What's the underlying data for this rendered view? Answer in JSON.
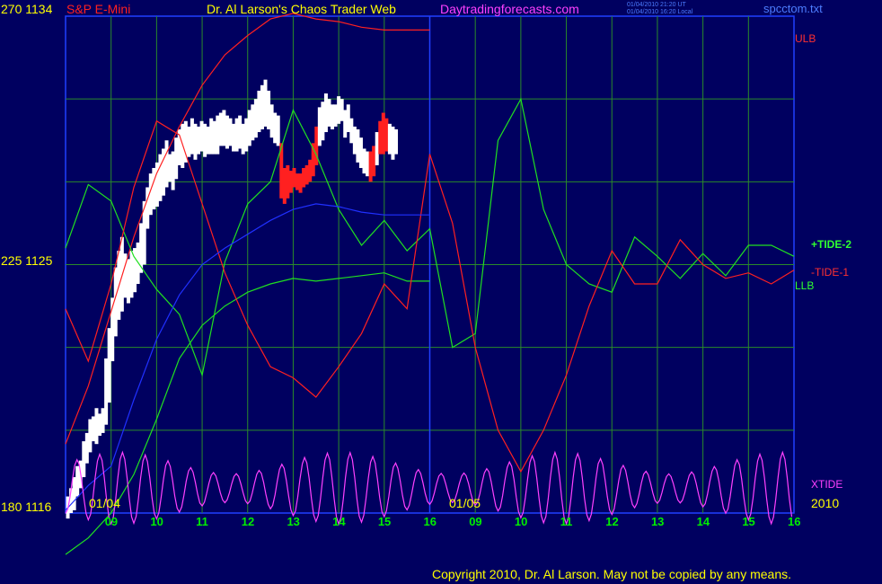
{
  "header": {
    "instrument": "S&P E-Mini",
    "title": "Dr. Al Larson's Chaos Trader Web",
    "site": "Daytradingforecasts.com",
    "timestamp_ut": "01/04/2010 21:20 UT",
    "timestamp_local": "01/04/2010 16:20 Local",
    "filename": "spcctom.txt"
  },
  "y_labels": {
    "top": "270  1134",
    "mid": "225  1125",
    "bottom": "180  1116"
  },
  "right_labels": {
    "ulb": "ULB",
    "tide2": "+TIDE-2",
    "tide1": "-TIDE-1",
    "llb": "LLB",
    "xtide": "XTIDE"
  },
  "date_labels": {
    "d1": "01/04",
    "d2": "01/05",
    "year": "2010"
  },
  "footer": {
    "copyright": "Copyright 2010, Dr. Al Larson. May not be copied by any means."
  },
  "chart_data": {
    "type": "line",
    "xlabel": "",
    "ylabel": "",
    "x_tick_labels": [
      "09",
      "10",
      "11",
      "12",
      "13",
      "14",
      "15",
      "16",
      "09",
      "10",
      "11",
      "12",
      "13",
      "14",
      "15",
      "16"
    ],
    "ylim_price": [
      1116,
      1134
    ],
    "ylim_tide": [
      180,
      270
    ],
    "grid": true,
    "series": [
      {
        "name": "ULB",
        "color": "#ff2020",
        "x": [
          0,
          0.5,
          1,
          1.5,
          2,
          2.5,
          3,
          3.5,
          4,
          4.5,
          5,
          5.5,
          6,
          6.5,
          7,
          7.5,
          8
        ],
        "y": [
          1118.5,
          1120.6,
          1123.3,
          1126.0,
          1128.3,
          1130.0,
          1131.5,
          1132.6,
          1133.3,
          1133.9,
          1134.1,
          1133.9,
          1133.8,
          1133.6,
          1133.5,
          1133.5,
          1133.5
        ]
      },
      {
        "name": "+TIDE-2",
        "color": "#20e020",
        "x": [
          0,
          0.5,
          1,
          1.5,
          2,
          2.5,
          3,
          3.5,
          4,
          4.5,
          5,
          5.5,
          6,
          6.5,
          7,
          7.5,
          8,
          8.5,
          9,
          9.5,
          10,
          10.5,
          11,
          11.5,
          12,
          12.5,
          13,
          13.5,
          14,
          14.5,
          15,
          15.5,
          16
        ],
        "y": [
          1125.6,
          1127.9,
          1127.3,
          1125.3,
          1124.1,
          1123.2,
          1121.0,
          1125.1,
          1127.2,
          1128.0,
          1130.6,
          1129.0,
          1127.0,
          1125.7,
          1126.6,
          1125.5,
          1126.3,
          1122.0,
          1122.5,
          1129.5,
          1131.0,
          1127.0,
          1125.0,
          1124.3,
          1124.0,
          1126.0,
          1125.3,
          1124.5,
          1125.4,
          1124.6,
          1125.7,
          1125.7,
          1125.3
        ]
      },
      {
        "name": "LLB",
        "color": "#20e020",
        "x": [
          0,
          0.5,
          1,
          1.5,
          2,
          2.5,
          3,
          3.5,
          4,
          4.5,
          5,
          5.5,
          6,
          6.5,
          7,
          7.5,
          8
        ],
        "y": [
          1114.5,
          1115.1,
          1116.0,
          1117.4,
          1119.4,
          1121.6,
          1122.8,
          1123.5,
          1124.0,
          1124.3,
          1124.5,
          1124.4,
          1124.5,
          1124.6,
          1124.7,
          1124.4,
          1124.4
        ]
      },
      {
        "name": "-TIDE-1",
        "color": "#ff2020",
        "x": [
          0,
          0.5,
          1,
          1.5,
          2,
          2.5,
          3,
          3.5,
          4,
          4.5,
          5,
          5.5,
          6,
          6.5,
          7,
          7.5,
          8,
          8.5,
          9,
          9.5,
          10,
          10.5,
          11,
          11.5,
          12,
          12.5,
          13,
          13.5,
          14,
          14.5,
          15,
          15.5,
          16
        ],
        "y": [
          1123.4,
          1121.5,
          1124.3,
          1127.8,
          1130.2,
          1129.7,
          1127.2,
          1124.7,
          1122.8,
          1121.3,
          1120.9,
          1120.2,
          1121.3,
          1122.5,
          1124.3,
          1123.4,
          1129.0,
          1126.5,
          1122.0,
          1119.0,
          1117.5,
          1119.0,
          1121.0,
          1123.5,
          1125.5,
          1124.3,
          1124.3,
          1125.9,
          1125.0,
          1124.5,
          1124.7,
          1124.3,
          1124.8
        ]
      },
      {
        "name": "Price MA",
        "color": "#2030ff",
        "x": [
          0,
          0.5,
          1,
          1.5,
          2,
          2.5,
          3,
          3.5,
          4,
          4.5,
          5,
          5.5,
          6,
          6.5,
          7,
          7.5,
          8
        ],
        "y": [
          1116.1,
          1117.0,
          1117.7,
          1120.1,
          1122.3,
          1123.9,
          1125.0,
          1125.6,
          1126.1,
          1126.6,
          1127.0,
          1127.2,
          1127.1,
          1126.9,
          1126.8,
          1126.8,
          1126.8
        ]
      },
      {
        "name": "XTIDE",
        "color": "#ff40ff",
        "period": 0.5,
        "phase": 0.25,
        "center": 1116.9,
        "amp": 1.3,
        "range": [
          0,
          16
        ]
      }
    ],
    "price_bars": [
      {
        "x": 0.05,
        "lo": 1115.8,
        "hi": 1116.6
      },
      {
        "x": 0.12,
        "lo": 1116.0,
        "hi": 1116.9
      },
      {
        "x": 0.19,
        "lo": 1116.1,
        "hi": 1117.3
      },
      {
        "x": 0.26,
        "lo": 1116.6,
        "hi": 1117.7
      },
      {
        "x": 0.33,
        "lo": 1116.9,
        "hi": 1117.9
      },
      {
        "x": 0.4,
        "lo": 1117.3,
        "hi": 1118.6
      },
      {
        "x": 0.47,
        "lo": 1117.8,
        "hi": 1118.9
      },
      {
        "x": 0.54,
        "lo": 1118.2,
        "hi": 1119.4
      },
      {
        "x": 0.61,
        "lo": 1118.6,
        "hi": 1119.5
      },
      {
        "x": 0.68,
        "lo": 1118.5,
        "hi": 1119.8
      },
      {
        "x": 0.75,
        "lo": 1118.8,
        "hi": 1119.6
      },
      {
        "x": 0.82,
        "lo": 1118.9,
        "hi": 1119.8
      },
      {
        "x": 0.89,
        "lo": 1119.2,
        "hi": 1121.6
      },
      {
        "x": 0.96,
        "lo": 1120.0,
        "hi": 1122.7
      },
      {
        "x": 1.03,
        "lo": 1121.5,
        "hi": 1123.8
      },
      {
        "x": 1.1,
        "lo": 1122.4,
        "hi": 1124.9
      },
      {
        "x": 1.17,
        "lo": 1123.0,
        "hi": 1125.5
      },
      {
        "x": 1.24,
        "lo": 1123.3,
        "hi": 1126.0
      },
      {
        "x": 1.31,
        "lo": 1123.8,
        "hi": 1125.4
      },
      {
        "x": 1.38,
        "lo": 1123.6,
        "hi": 1125.2
      },
      {
        "x": 1.45,
        "lo": 1123.8,
        "hi": 1125.5
      },
      {
        "x": 1.52,
        "lo": 1124.0,
        "hi": 1125.6
      },
      {
        "x": 1.59,
        "lo": 1124.3,
        "hi": 1125.8
      },
      {
        "x": 1.66,
        "lo": 1124.7,
        "hi": 1126.5
      },
      {
        "x": 1.73,
        "lo": 1125.0,
        "hi": 1127.3
      },
      {
        "x": 1.8,
        "lo": 1126.3,
        "hi": 1127.8
      },
      {
        "x": 1.87,
        "lo": 1126.8,
        "hi": 1128.3
      },
      {
        "x": 1.94,
        "lo": 1127.0,
        "hi": 1128.5
      },
      {
        "x": 2.01,
        "lo": 1127.1,
        "hi": 1128.7
      },
      {
        "x": 2.08,
        "lo": 1127.3,
        "hi": 1129.0
      },
      {
        "x": 2.15,
        "lo": 1127.5,
        "hi": 1129.2
      },
      {
        "x": 2.22,
        "lo": 1127.8,
        "hi": 1129.5
      },
      {
        "x": 2.29,
        "lo": 1128.0,
        "hi": 1129.0
      },
      {
        "x": 2.36,
        "lo": 1127.7,
        "hi": 1129.1
      },
      {
        "x": 2.43,
        "lo": 1128.1,
        "hi": 1129.6
      },
      {
        "x": 2.5,
        "lo": 1128.6,
        "hi": 1129.9
      },
      {
        "x": 2.57,
        "lo": 1128.5,
        "hi": 1130.1
      },
      {
        "x": 2.64,
        "lo": 1128.7,
        "hi": 1130.2
      },
      {
        "x": 2.71,
        "lo": 1128.9,
        "hi": 1130.0
      },
      {
        "x": 2.78,
        "lo": 1129.0,
        "hi": 1130.3
      },
      {
        "x": 2.85,
        "lo": 1128.8,
        "hi": 1130.1
      },
      {
        "x": 2.92,
        "lo": 1129.0,
        "hi": 1130.0
      },
      {
        "x": 2.99,
        "lo": 1129.1,
        "hi": 1130.2
      },
      {
        "x": 3.06,
        "lo": 1128.9,
        "hi": 1130.1
      },
      {
        "x": 3.13,
        "lo": 1129.0,
        "hi": 1130.0
      },
      {
        "x": 3.2,
        "lo": 1129.0,
        "hi": 1130.3
      },
      {
        "x": 3.27,
        "lo": 1129.0,
        "hi": 1130.2
      },
      {
        "x": 3.34,
        "lo": 1129.0,
        "hi": 1130.4
      },
      {
        "x": 3.41,
        "lo": 1129.3,
        "hi": 1130.5
      },
      {
        "x": 3.48,
        "lo": 1129.3,
        "hi": 1130.6
      },
      {
        "x": 3.55,
        "lo": 1129.2,
        "hi": 1130.4
      },
      {
        "x": 3.62,
        "lo": 1129.3,
        "hi": 1130.3
      },
      {
        "x": 3.69,
        "lo": 1129.1,
        "hi": 1130.1
      },
      {
        "x": 3.76,
        "lo": 1129.1,
        "hi": 1130.3
      },
      {
        "x": 3.83,
        "lo": 1129.2,
        "hi": 1130.4
      },
      {
        "x": 3.9,
        "lo": 1129.0,
        "hi": 1130.1
      },
      {
        "x": 3.97,
        "lo": 1129.1,
        "hi": 1130.3
      },
      {
        "x": 4.04,
        "lo": 1129.3,
        "hi": 1130.6
      },
      {
        "x": 4.11,
        "lo": 1129.5,
        "hi": 1130.8
      },
      {
        "x": 4.18,
        "lo": 1129.6,
        "hi": 1131.0
      },
      {
        "x": 4.25,
        "lo": 1129.8,
        "hi": 1131.3
      },
      {
        "x": 4.32,
        "lo": 1129.9,
        "hi": 1131.5
      },
      {
        "x": 4.39,
        "lo": 1130.0,
        "hi": 1131.7
      },
      {
        "x": 4.46,
        "lo": 1129.9,
        "hi": 1131.3
      },
      {
        "x": 4.53,
        "lo": 1129.6,
        "hi": 1130.8
      },
      {
        "x": 4.6,
        "lo": 1129.4,
        "hi": 1130.5
      },
      {
        "x": 4.67,
        "lo": 1129.3,
        "hi": 1130.4
      },
      {
        "x": 4.74,
        "lo": 1127.4,
        "hi": 1129.4,
        "r": 1
      },
      {
        "x": 4.81,
        "lo": 1127.2,
        "hi": 1128.5,
        "r": 1
      },
      {
        "x": 4.88,
        "lo": 1127.4,
        "hi": 1128.6,
        "r": 1
      },
      {
        "x": 4.95,
        "lo": 1127.6,
        "hi": 1128.4,
        "r": 1
      },
      {
        "x": 5.02,
        "lo": 1127.8,
        "hi": 1128.5,
        "r": 1
      },
      {
        "x": 5.09,
        "lo": 1127.7,
        "hi": 1128.3,
        "r": 1
      },
      {
        "x": 5.16,
        "lo": 1127.6,
        "hi": 1128.3,
        "r": 1
      },
      {
        "x": 5.23,
        "lo": 1127.8,
        "hi": 1128.5,
        "r": 1
      },
      {
        "x": 5.3,
        "lo": 1127.9,
        "hi": 1128.6,
        "r": 1
      },
      {
        "x": 5.37,
        "lo": 1128.0,
        "hi": 1128.8,
        "r": 1
      },
      {
        "x": 5.44,
        "lo": 1128.2,
        "hi": 1129.4,
        "r": 1
      },
      {
        "x": 5.51,
        "lo": 1128.6,
        "hi": 1130.0,
        "r": 1
      },
      {
        "x": 5.58,
        "lo": 1129.3,
        "hi": 1130.7
      },
      {
        "x": 5.65,
        "lo": 1129.5,
        "hi": 1130.9
      },
      {
        "x": 5.72,
        "lo": 1129.8,
        "hi": 1131.2
      },
      {
        "x": 5.79,
        "lo": 1130.0,
        "hi": 1131.0
      },
      {
        "x": 5.86,
        "lo": 1129.9,
        "hi": 1130.8
      },
      {
        "x": 5.93,
        "lo": 1130.0,
        "hi": 1130.8
      },
      {
        "x": 6.0,
        "lo": 1130.1,
        "hi": 1131.1
      },
      {
        "x": 6.07,
        "lo": 1130.2,
        "hi": 1131.0
      },
      {
        "x": 6.14,
        "lo": 1129.6,
        "hi": 1130.6
      },
      {
        "x": 6.21,
        "lo": 1129.8,
        "hi": 1130.8
      },
      {
        "x": 6.28,
        "lo": 1129.4,
        "hi": 1130.3
      },
      {
        "x": 6.35,
        "lo": 1129.0,
        "hi": 1130.0
      },
      {
        "x": 6.42,
        "lo": 1128.7,
        "hi": 1129.9
      },
      {
        "x": 6.49,
        "lo": 1128.5,
        "hi": 1129.6
      },
      {
        "x": 6.56,
        "lo": 1128.3,
        "hi": 1129.2
      },
      {
        "x": 6.63,
        "lo": 1128.2,
        "hi": 1129.1
      },
      {
        "x": 6.7,
        "lo": 1128.0,
        "hi": 1129.1,
        "r": 1
      },
      {
        "x": 6.77,
        "lo": 1128.2,
        "hi": 1129.3,
        "r": 1
      },
      {
        "x": 6.84,
        "lo": 1128.6,
        "hi": 1129.8
      },
      {
        "x": 6.91,
        "lo": 1129.0,
        "hi": 1130.2,
        "r": 1
      },
      {
        "x": 6.98,
        "lo": 1129.0,
        "hi": 1130.5,
        "r": 1
      },
      {
        "x": 7.05,
        "lo": 1129.1,
        "hi": 1130.3,
        "r": 1
      },
      {
        "x": 7.12,
        "lo": 1129.0,
        "hi": 1130.1
      },
      {
        "x": 7.19,
        "lo": 1128.8,
        "hi": 1130.0
      },
      {
        "x": 7.26,
        "lo": 1129.0,
        "hi": 1129.9
      }
    ]
  }
}
